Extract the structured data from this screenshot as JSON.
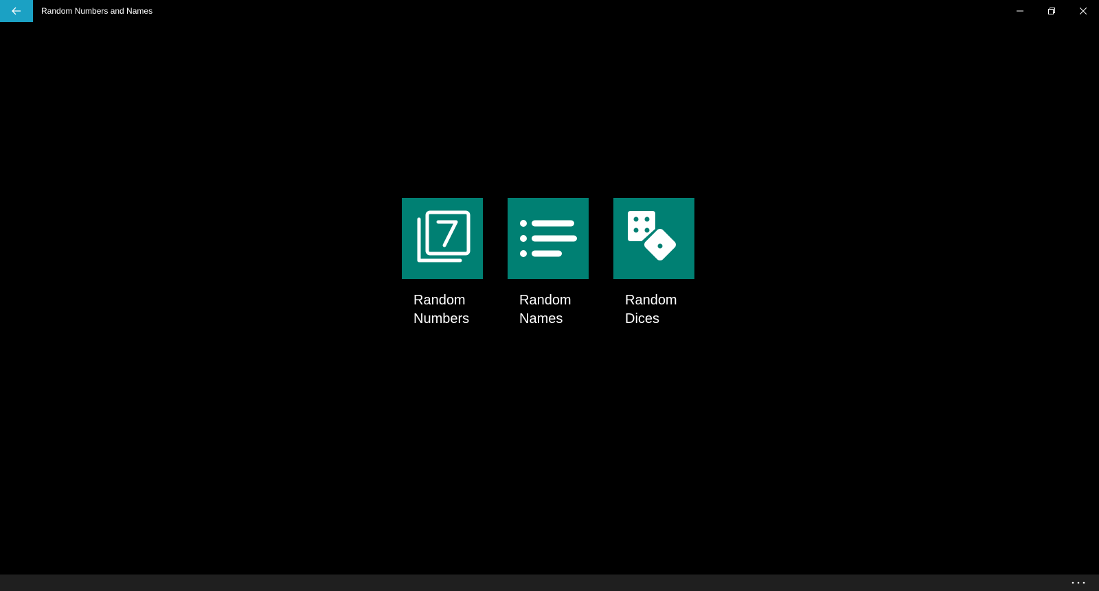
{
  "window": {
    "title": "Random Numbers and Names",
    "accent_color": "#1ba1c4",
    "back_icon": "arrow-left-icon",
    "minimize_icon": "minimize-icon",
    "restore_icon": "restore-icon",
    "close_icon": "close-icon"
  },
  "tiles": [
    {
      "line1": "Random",
      "line2": "Numbers",
      "icon": "number-card-icon"
    },
    {
      "line1": "Random",
      "line2": "Names",
      "icon": "list-icon"
    },
    {
      "line1": "Random",
      "line2": "Dices",
      "icon": "dice-icon"
    }
  ],
  "tile_color": "#008073",
  "appbar": {
    "more_icon": "more-ellipsis-icon"
  }
}
